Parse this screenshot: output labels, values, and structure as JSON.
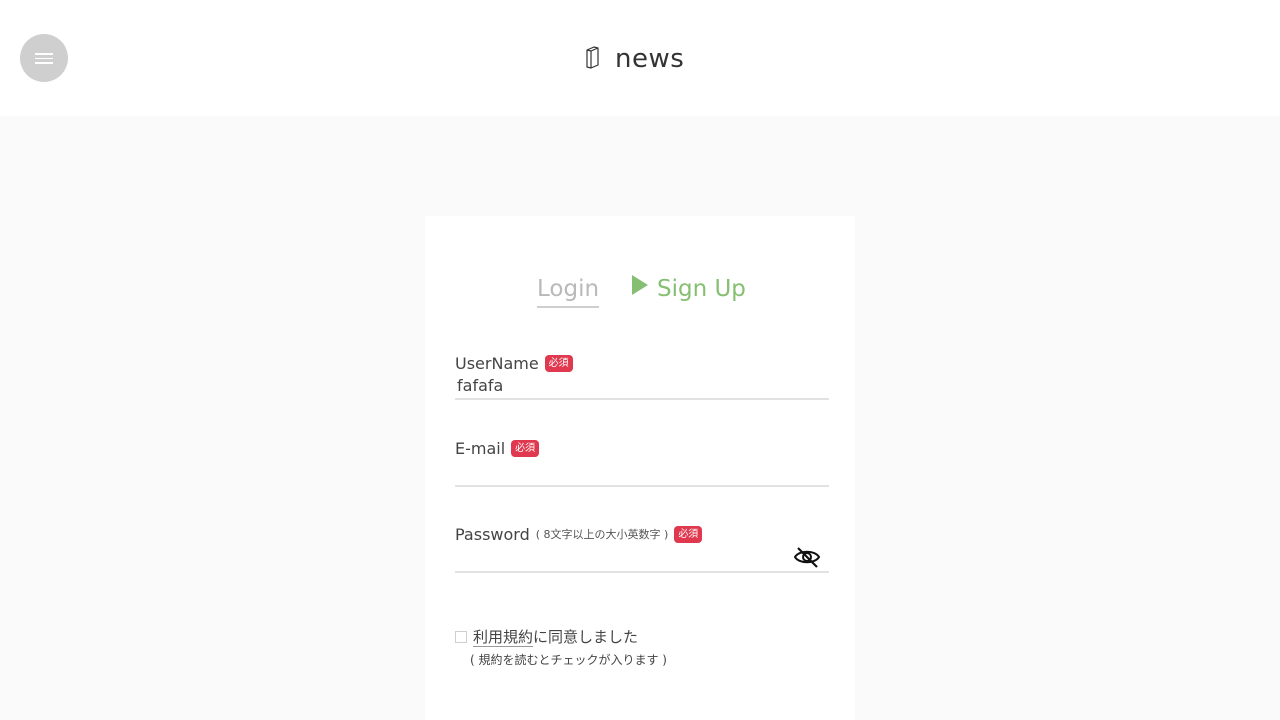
{
  "header": {
    "brand_icon": "book-icon",
    "brand_text": "news",
    "menu_icon": "hamburger-menu-icon"
  },
  "tabs": {
    "login_label": "Login",
    "signup_label": "Sign Up",
    "active": "signup",
    "active_color": "#86bf72"
  },
  "form": {
    "username": {
      "label": "UserName",
      "required_badge": "必須",
      "value": "fafafa"
    },
    "email": {
      "label": "E-mail",
      "required_badge": "必須",
      "value": ""
    },
    "password": {
      "label": "Password",
      "note": "( 8文字以上の大小英数字 )",
      "required_badge": "必須",
      "value": "",
      "toggle_icon": "eye-slash-icon"
    },
    "agree": {
      "link_text": "利用規約",
      "text_suffix": "に同意しました",
      "note": "( 規約を読むとチェックが入ります )",
      "checked": false
    }
  },
  "colors": {
    "required_badge": "#e0394f",
    "accent": "#86bf72"
  }
}
